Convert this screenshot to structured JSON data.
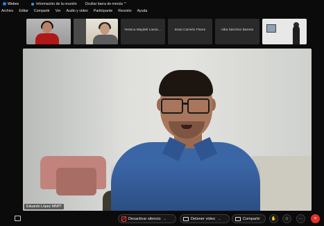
{
  "topbar": {
    "app_name": "Webex",
    "meeting_info": "Información de la reunión",
    "hide_menu": "Ocultar barra de menús",
    "chevron": "^"
  },
  "menu": [
    "Archivo",
    "Editar",
    "Compartir",
    "Ver",
    "Audio y vídeo",
    "Participante",
    "Reunión",
    "Ayuda"
  ],
  "participants": [
    {
      "name": "",
      "type": "video-red"
    },
    {
      "name": "",
      "type": "video-room"
    },
    {
      "name": "Yessica Maydeli Loeza ...",
      "type": "name"
    },
    {
      "name": "Esaú Carreón Flores",
      "type": "name"
    },
    {
      "name": "Alba Sánchez Barreto",
      "type": "name"
    },
    {
      "name": "",
      "type": "video-white"
    }
  ],
  "main_video": {
    "speaker_name": "Eduardo López MNPT"
  },
  "controls": {
    "mute_label": "Desactivar silencio",
    "video_label": "Detener vídeo",
    "share_label": "Compartir",
    "chevron": "⌄",
    "hand_icon": "✋",
    "reaction_icon": "☺",
    "more_icon": "···",
    "end_icon": "×"
  }
}
